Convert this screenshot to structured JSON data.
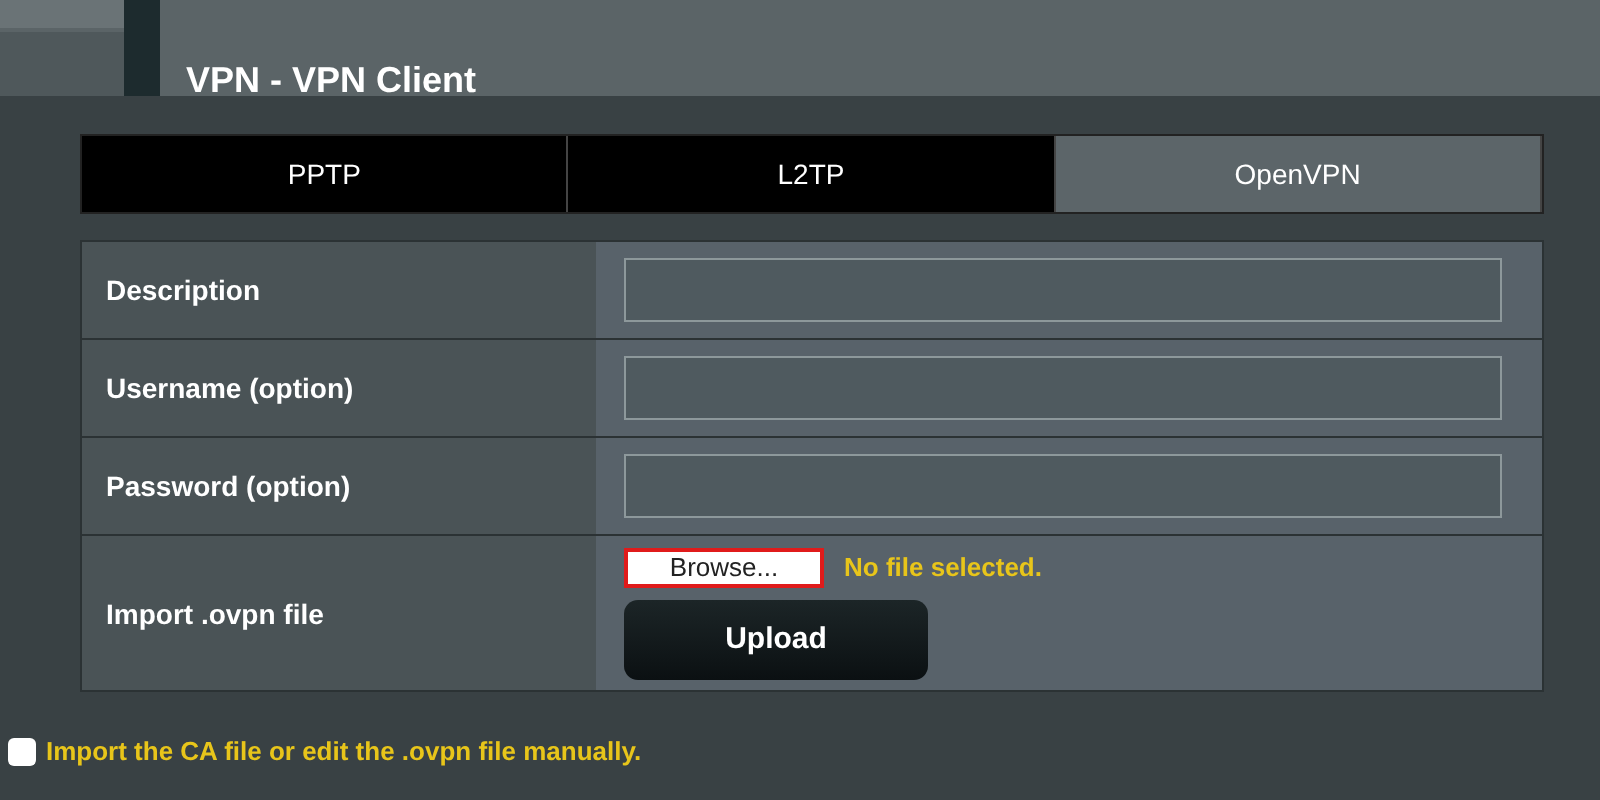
{
  "page_title": "VPN - VPN Client",
  "tabs": [
    {
      "label": "PPTP",
      "selected": false
    },
    {
      "label": "L2TP",
      "selected": false
    },
    {
      "label": "OpenVPN",
      "selected": true
    }
  ],
  "fields": [
    {
      "kind": "text",
      "label": "Description"
    },
    {
      "kind": "text",
      "label": "Username (option)"
    },
    {
      "kind": "text",
      "label": "Password (option)"
    },
    {
      "kind": "file",
      "label": "Import .ovpn file",
      "browse": "Browse...",
      "status": "No file selected.",
      "upload": "Upload"
    }
  ],
  "manual_option": {
    "label": "Import the CA file or edit the .ovpn file manually.",
    "checked": false
  }
}
